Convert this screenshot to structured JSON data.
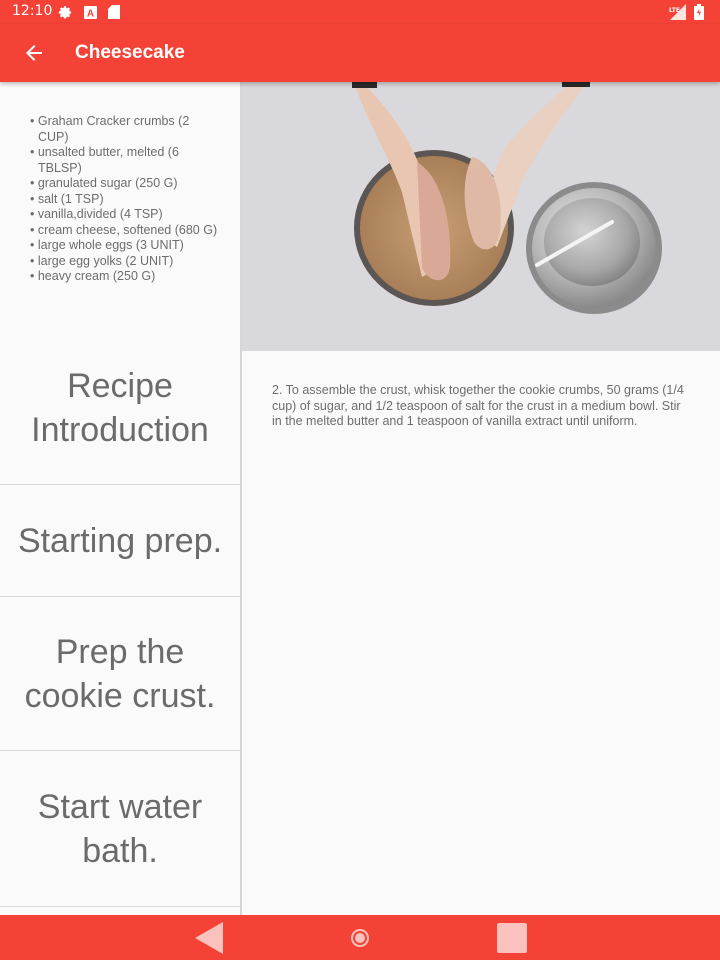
{
  "status_bar": {
    "time": "12:10",
    "left_icons": [
      "settings-icon",
      "a-icon",
      "sd-card-icon"
    ],
    "right_icons": [
      "lte-signal-icon",
      "battery-icon"
    ],
    "network": "LTE"
  },
  "app_bar": {
    "title": "Cheesecake",
    "back_icon": "arrow-back-icon",
    "color": "#f44336"
  },
  "ingredients": [
    "• Graham Cracker crumbs (2 CUP)",
    "• unsalted butter, melted (6 TBLSP)",
    "• granulated sugar (250 G)",
    "• salt (1 TSP)",
    "• vanilla,divided (4 TSP)",
    "• cream cheese, softened (680 G)",
    "• large whole eggs (3 UNIT)",
    "• large egg yolks (2 UNIT)",
    "• heavy cream (250 G)"
  ],
  "steps": [
    "Recipe Introduction",
    "Starting prep.",
    "Prep the cookie crust.",
    "Start water bath."
  ],
  "video": {
    "subject": "hands mixing cookie crumbs in a metal bowl beside a bowl of melted butter"
  },
  "step_description": "2. To assemble the crust, whisk together the cookie crumbs, 50 grams (1/4 cup) of sugar, and 1/2 teaspoon of salt for the crust in a medium bowl. Stir in the melted butter and 1 teaspoon of vanilla extract until uniform.",
  "nav_bar": {
    "icons": [
      "back-triangle-icon",
      "home-circle-icon",
      "recents-square-icon"
    ]
  }
}
